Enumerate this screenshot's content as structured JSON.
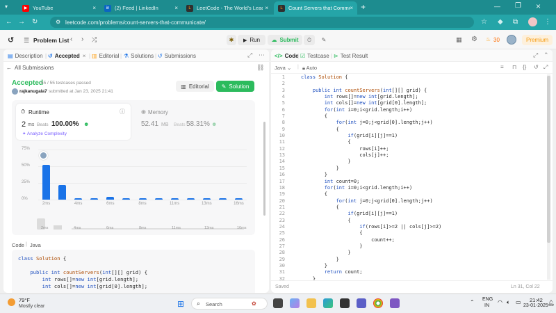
{
  "browser": {
    "tabs": [
      {
        "title": "YouTube",
        "icon": "youtube-icon",
        "color": "#ff0000"
      },
      {
        "title": "(2) Feed | LinkedIn",
        "icon": "linkedin-icon",
        "color": "#0a66c2"
      },
      {
        "title": "LeetCode - The World's Leading",
        "icon": "leetcode-icon",
        "color": "#ffa116"
      },
      {
        "title": "Count Servers that Communicate",
        "icon": "leetcode-icon",
        "color": "#ffa116"
      }
    ],
    "url": "leetcode.com/problems/count-servers-that-communicate/"
  },
  "lc_header": {
    "problem_list": "Problem List",
    "run": "Run",
    "submit": "Submit",
    "streak": "30",
    "premium": "Premium"
  },
  "left_panel": {
    "tabs": [
      "Description",
      "Accepted",
      "Editorial",
      "Solutions",
      "Submissions"
    ],
    "all_submissions": "All Submissions",
    "status": "Accepted",
    "testcases": "55 / 55 testcases passed",
    "user": "rajkanugala7",
    "submitted": "submitted at Jan 23, 2025 21:41",
    "editorial_btn": "Editorial",
    "solution_btn": "Solution",
    "runtime": {
      "label": "Runtime",
      "value": "2",
      "unit": "ms",
      "beats_label": "Beats",
      "beats": "100.00%",
      "analyze": "Analyze Complexity"
    },
    "memory": {
      "label": "Memory",
      "value": "52.41",
      "unit": "MB",
      "beats_label": "Beats",
      "beats": "58.31%"
    },
    "code_label": "Code",
    "lang": "Java",
    "code_lines": [
      "class Solution {",
      "",
      "    public int countServers(int[][] grid) {",
      "        int rows[]=new int[grid.length];",
      "        int cols[]=new int[grid[0].length];"
    ]
  },
  "chart_data": {
    "type": "bar",
    "categories": [
      "2ms",
      "",
      "4ms",
      "",
      "6ms",
      "",
      "8ms",
      "",
      "11ms",
      "",
      "13ms",
      "",
      "16ms"
    ],
    "values": [
      52,
      22,
      2,
      2,
      4,
      2,
      2,
      2,
      2,
      2,
      2,
      2,
      2
    ],
    "yticks": [
      "75%",
      "50%",
      "25%",
      "0%"
    ],
    "ylim": [
      0,
      75
    ],
    "color": "#1a73e8",
    "highlight": "2ms"
  },
  "mini_axis": [
    "2ms",
    "4ms",
    "6ms",
    "8ms",
    "11ms",
    "13ms",
    "16ms"
  ],
  "right_panel": {
    "tabs": [
      "Code",
      "Testcase",
      "Test Result"
    ],
    "lang": "Java",
    "auto": "Auto",
    "status": "Saved",
    "cursor": "Ln 31, Col 22",
    "code_lines": [
      "class Solution {",
      "",
      "    public int countServers(int[][] grid) {",
      "        int rows[]=new int[grid.length];",
      "        int cols[]=new int[grid[0].length];",
      "        for(int i=0;i<grid.length;i++)",
      "        {",
      "            for(int j=0;j<grid[0].length;j++)",
      "            {",
      "                if(grid[i][j]==1)",
      "                {",
      "                    rows[i]++;",
      "                    cols[j]++;",
      "                }",
      "            }",
      "        }",
      "        int count=0;",
      "        for(int i=0;i<grid.length;i++)",
      "        {",
      "            for(int j=0;j<grid[0].length;j++)",
      "            {",
      "                if(grid[i][j]==1)",
      "                {",
      "                    if(rows[i]>=2 || cols[j]>=2)",
      "                    {",
      "                        count++;",
      "                    }",
      "                }",
      "            }",
      "        }",
      "        return count;",
      "    }"
    ]
  },
  "taskbar": {
    "temp": "79°F",
    "weather": "Mostly clear",
    "search": "Search",
    "lang1": "ENG",
    "lang2": "IN",
    "time": "21:42",
    "date": "23-01-2025"
  }
}
